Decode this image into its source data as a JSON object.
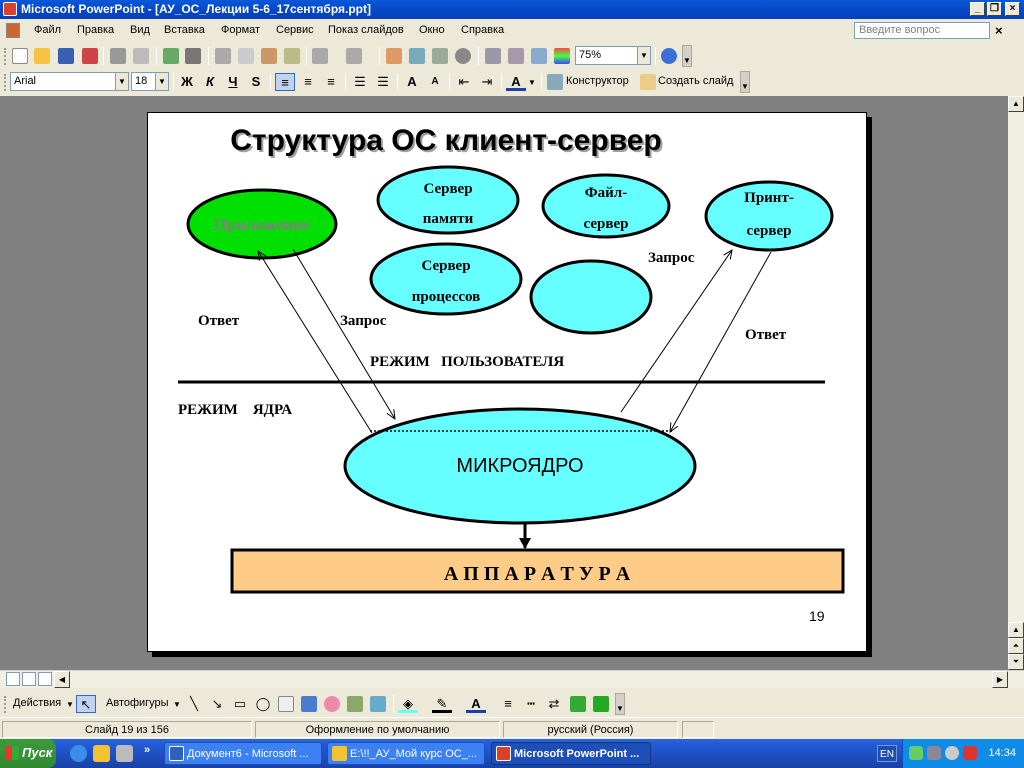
{
  "window": {
    "title": "Microsoft PowerPoint - [АУ_ОС_Лекции 5-6_17сентября.ppt]"
  },
  "menu": {
    "items": [
      "Файл",
      "Правка",
      "Вид",
      "Вставка",
      "Формат",
      "Сервис",
      "Показ слайдов",
      "Окно",
      "Справка"
    ],
    "ask_placeholder": "Введите вопрос"
  },
  "standard_toolbar": {
    "zoom": "75%"
  },
  "format_toolbar": {
    "font": "Arial",
    "size": "18",
    "bold": "Ж",
    "italic": "К",
    "underline": "Ч",
    "shadow": "S",
    "designer": "Конструктор",
    "new_slide": "Создать слайд"
  },
  "slide": {
    "title": "Структура ОС клиент-сервер",
    "nodes": {
      "app": "Приложение",
      "memory_server": [
        "Сервер",
        "памяти"
      ],
      "file_server": [
        "Файл-",
        "сервер"
      ],
      "print_server": [
        "Принт-",
        "сервер"
      ],
      "process_server": [
        "Сервер",
        "процессов"
      ],
      "microkernel": "МИКРОЯДРО",
      "hardware": "А П П А Р А Т У Р А"
    },
    "labels": {
      "answer_left": "Ответ",
      "request_left": "Запрос",
      "request_right": "Запрос",
      "answer_right": "Ответ",
      "user_mode": "РЕЖИМ   ПОЛЬЗОВАТЕЛЯ",
      "kernel_mode": "РЕЖИМ    ЯДРА"
    },
    "number": "19",
    "colors": {
      "cyan": "#66ffff",
      "green": "#00e000",
      "hardware": "#ffcc88",
      "app_text": "#808080"
    }
  },
  "draw_toolbar": {
    "actions": "Действия",
    "autoshapes": "Автофигуры"
  },
  "status": {
    "slide": "Слайд 19 из 156",
    "design": "Оформление по умолчанию",
    "language": "русский (Россия)"
  },
  "taskbar": {
    "start": "Пуск",
    "tasks": [
      {
        "label": "Документ6 - Microsoft ...",
        "active": false
      },
      {
        "label": "E:\\!!_АУ_Мой курс ОС_...",
        "active": false
      },
      {
        "label": "Microsoft PowerPoint ...",
        "active": true
      }
    ],
    "lang": "EN",
    "clock": "14:34"
  }
}
